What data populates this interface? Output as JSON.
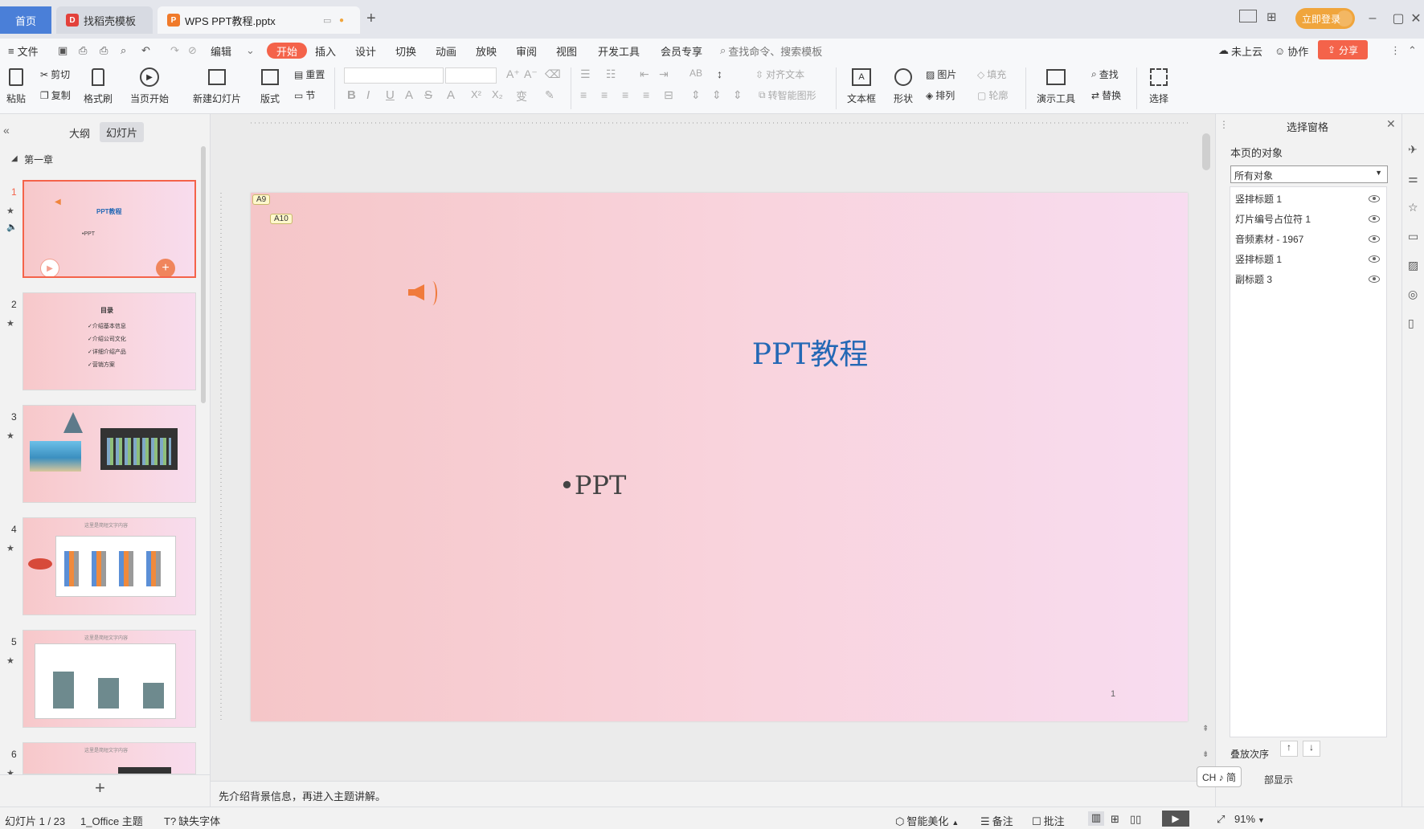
{
  "titlebar": {
    "home_tab": "首页",
    "template_tab": "找稻壳模板",
    "doc_tab": "WPS PPT教程.pptx",
    "login": "立即登录"
  },
  "menubar": {
    "file": "文件",
    "items": [
      "编辑",
      "开始",
      "插入",
      "设计",
      "切换",
      "动画",
      "放映",
      "审阅",
      "视图",
      "开发工具",
      "会员专享"
    ],
    "search": "查找命令、搜索模板",
    "cloud": "未上云",
    "collab": "协作",
    "share": "分享"
  },
  "ribbon": {
    "paste": "粘贴",
    "cut": "剪切",
    "copy": "复制",
    "format_painter": "格式刷",
    "from_current": "当页开始",
    "new_slide": "新建幻灯片",
    "layout": "版式",
    "reset": "重置",
    "section": "节",
    "align_text": "对齐文本",
    "smartart": "转智能图形",
    "textbox": "文本框",
    "shape": "形状",
    "picture": "图片",
    "arrange": "排列",
    "fill": "填充",
    "outline": "轮廓",
    "present_tool": "演示工具",
    "find": "查找",
    "replace": "替换",
    "select": "选择"
  },
  "leftpanel": {
    "outline_tab": "大纲",
    "slides_tab": "幻灯片",
    "section": "第一章",
    "thumbs": [
      {
        "num": "1",
        "title": "PPT教程",
        "sub": "•PPT"
      },
      {
        "num": "2",
        "title": "目录",
        "lines": [
          "✓介绍基本信息",
          "✓介绍公司文化",
          "✓详细介绍产品",
          "✓营销方案"
        ]
      },
      {
        "num": "3"
      },
      {
        "num": "4",
        "title": "这里是简短文字内容"
      },
      {
        "num": "5",
        "title": "这里是简短文字内容"
      },
      {
        "num": "6",
        "title": "这里是简短文字内容"
      }
    ]
  },
  "slide": {
    "tag_a9": "A9",
    "tag_a10": "A10",
    "title": "PPT教程",
    "subtitle": "•PPT",
    "number": "1"
  },
  "notes": "先介绍背景信息，再进入主题讲解。",
  "rightpanel": {
    "title": "选择窗格",
    "section_label": "本页的对象",
    "filter": "所有对象",
    "objects": [
      "竖排标题 1",
      "灯片编号占位符 1",
      "音频素材 - 1967",
      "竖排标题 1",
      "副标题 3"
    ],
    "order_label": "叠放次序",
    "show_all": "部显示",
    "ime": "CH ♪ 简"
  },
  "statusbar": {
    "slide_info": "幻灯片 1 / 23",
    "theme": "1_Office 主题",
    "missing_font": "缺失字体",
    "beautify": "智能美化",
    "notes": "备注",
    "comments": "批注",
    "zoom": "91%"
  },
  "colors": {
    "accent": "#f4634a",
    "title_blue": "#2468b5",
    "home_tab": "#4a7fd8",
    "login": "#f0a53c"
  }
}
